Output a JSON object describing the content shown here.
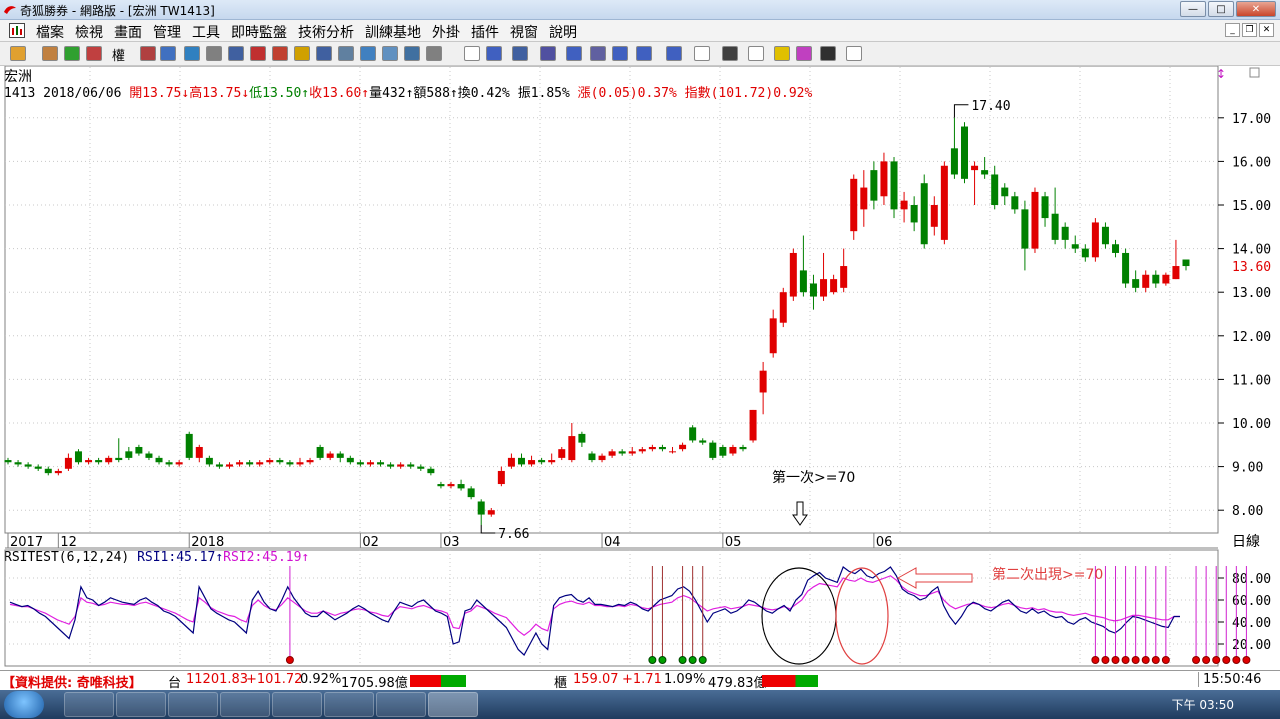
{
  "window": {
    "title": "奇狐勝券 - 網路版 - [宏洲 TW1413]",
    "min": "—",
    "max": "□",
    "close": "✕"
  },
  "menu": [
    "檔案",
    "檢視",
    "畫面",
    "管理",
    "工具",
    "即時監盤",
    "技術分析",
    "訓練基地",
    "外掛",
    "插件",
    "視窗",
    "說明"
  ],
  "toolbar": {
    "rights_label": "權"
  },
  "stock": {
    "name": "宏洲",
    "line2": [
      {
        "text": "1413 2018/06/06 ",
        "color": "blk"
      },
      {
        "text": "開13.75↓",
        "color": "red"
      },
      {
        "text": "高13.75↓",
        "color": "red"
      },
      {
        "text": "低13.50↑",
        "color": "green"
      },
      {
        "text": "收13.60↑",
        "color": "red"
      },
      {
        "text": "量432↑",
        "color": "blk"
      },
      {
        "text": "額588↑",
        "color": "blk"
      },
      {
        "text": "換0.42% ",
        "color": "blk"
      },
      {
        "text": "振1.85% ",
        "color": "blk"
      },
      {
        "text": "漲(0.05)0.37% ",
        "color": "red"
      },
      {
        "text": "指數(101.72)0.92%",
        "color": "red"
      }
    ]
  },
  "rsi_header": [
    {
      "text": "RSITEST(6,12,24) ",
      "color": "blk"
    },
    {
      "text": "RSI1:45.17↑",
      "color": "navy"
    },
    {
      "text": "RSI2:45.19↑",
      "color": "mag"
    }
  ],
  "annotations": {
    "first": "第一次>=70",
    "second": "第二次出現>=70",
    "high": "17.40",
    "low": "7.66",
    "last_price": "13.60",
    "period": "日線"
  },
  "chart_data": {
    "type": "candlestick",
    "ylim": [
      7.5,
      17.5
    ],
    "y_ticks": [
      "17.00",
      "16.00",
      "15.00",
      "14.00",
      "13.00",
      "12.00",
      "11.00",
      "10.00",
      "9.00",
      "8.00"
    ],
    "x_labels": [
      {
        "label": "2017",
        "i": 0
      },
      {
        "label": "12",
        "i": 5
      },
      {
        "label": "2018",
        "i": 18
      },
      {
        "label": "02",
        "i": 35
      },
      {
        "label": "03",
        "i": 43
      },
      {
        "label": "04",
        "i": 59
      },
      {
        "label": "05",
        "i": 71
      },
      {
        "label": "06",
        "i": 86
      }
    ],
    "rsi_ticks": [
      "80.00",
      "60.00",
      "40.00",
      "20.00"
    ],
    "rsi_ylim": [
      0,
      100
    ],
    "candles": [
      [
        9.15,
        9.1,
        9.2,
        9.05
      ],
      [
        9.1,
        9.05,
        9.15,
        9.0
      ],
      [
        9.05,
        9.0,
        9.1,
        8.95
      ],
      [
        9.0,
        8.95,
        9.05,
        8.9
      ],
      [
        8.95,
        8.85,
        9.0,
        8.8
      ],
      [
        8.85,
        8.9,
        8.95,
        8.8
      ],
      [
        8.95,
        9.2,
        9.3,
        8.9
      ],
      [
        9.35,
        9.1,
        9.4,
        9.05
      ],
      [
        9.1,
        9.15,
        9.2,
        9.05
      ],
      [
        9.15,
        9.1,
        9.2,
        9.05
      ],
      [
        9.1,
        9.2,
        9.25,
        9.05
      ],
      [
        9.2,
        9.15,
        9.65,
        9.1
      ],
      [
        9.35,
        9.2,
        9.45,
        9.15
      ],
      [
        9.45,
        9.3,
        9.5,
        9.25
      ],
      [
        9.3,
        9.2,
        9.35,
        9.15
      ],
      [
        9.2,
        9.1,
        9.25,
        9.05
      ],
      [
        9.1,
        9.05,
        9.15,
        9.0
      ],
      [
        9.05,
        9.1,
        9.15,
        9.0
      ],
      [
        9.75,
        9.2,
        9.8,
        9.15
      ],
      [
        9.2,
        9.45,
        9.5,
        9.1
      ],
      [
        9.2,
        9.05,
        9.25,
        9.0
      ],
      [
        9.05,
        9.0,
        9.1,
        8.95
      ],
      [
        9.0,
        9.05,
        9.1,
        8.95
      ],
      [
        9.05,
        9.1,
        9.15,
        9.0
      ],
      [
        9.1,
        9.05,
        9.15,
        9.0
      ],
      [
        9.05,
        9.1,
        9.15,
        9.0
      ],
      [
        9.1,
        9.15,
        9.2,
        9.05
      ],
      [
        9.15,
        9.1,
        9.2,
        9.05
      ],
      [
        9.1,
        9.05,
        9.15,
        9.0
      ],
      [
        9.05,
        9.1,
        9.2,
        9.0
      ],
      [
        9.1,
        9.15,
        9.2,
        9.05
      ],
      [
        9.45,
        9.2,
        9.5,
        9.15
      ],
      [
        9.2,
        9.3,
        9.35,
        9.15
      ],
      [
        9.3,
        9.2,
        9.35,
        9.1
      ],
      [
        9.2,
        9.1,
        9.25,
        9.05
      ],
      [
        9.1,
        9.05,
        9.15,
        9.0
      ],
      [
        9.05,
        9.1,
        9.15,
        9.0
      ],
      [
        9.1,
        9.05,
        9.15,
        9.0
      ],
      [
        9.05,
        9.0,
        9.1,
        8.95
      ],
      [
        9.0,
        9.05,
        9.1,
        8.95
      ],
      [
        9.05,
        9.0,
        9.1,
        8.95
      ],
      [
        9.0,
        8.95,
        9.05,
        8.9
      ],
      [
        8.95,
        8.85,
        9.0,
        8.8
      ],
      [
        8.6,
        8.55,
        8.65,
        8.5
      ],
      [
        8.55,
        8.6,
        8.65,
        8.5
      ],
      [
        8.6,
        8.5,
        8.7,
        8.45
      ],
      [
        8.5,
        8.3,
        8.55,
        8.25
      ],
      [
        8.2,
        7.9,
        8.25,
        7.66
      ],
      [
        7.9,
        8.0,
        8.05,
        7.85
      ],
      [
        8.6,
        8.9,
        9.0,
        8.55
      ],
      [
        9.0,
        9.2,
        9.3,
        8.95
      ],
      [
        9.2,
        9.05,
        9.3,
        9.0
      ],
      [
        9.05,
        9.15,
        9.25,
        9.0
      ],
      [
        9.15,
        9.1,
        9.2,
        9.05
      ],
      [
        9.1,
        9.15,
        9.3,
        9.05
      ],
      [
        9.2,
        9.4,
        9.45,
        9.15
      ],
      [
        9.15,
        9.7,
        10.0,
        9.1
      ],
      [
        9.75,
        9.55,
        9.8,
        9.45
      ],
      [
        9.3,
        9.15,
        9.35,
        9.1
      ],
      [
        9.15,
        9.25,
        9.3,
        9.1
      ],
      [
        9.25,
        9.35,
        9.4,
        9.2
      ],
      [
        9.35,
        9.3,
        9.4,
        9.25
      ],
      [
        9.3,
        9.35,
        9.45,
        9.25
      ],
      [
        9.35,
        9.4,
        9.45,
        9.3
      ],
      [
        9.4,
        9.45,
        9.5,
        9.35
      ],
      [
        9.45,
        9.4,
        9.5,
        9.35
      ],
      [
        9.35,
        9.35,
        9.45,
        9.3
      ],
      [
        9.4,
        9.5,
        9.55,
        9.35
      ],
      [
        9.9,
        9.6,
        9.95,
        9.55
      ],
      [
        9.6,
        9.55,
        9.65,
        9.5
      ],
      [
        9.55,
        9.2,
        9.6,
        9.15
      ],
      [
        9.45,
        9.25,
        9.5,
        9.2
      ],
      [
        9.3,
        9.45,
        9.5,
        9.25
      ],
      [
        9.45,
        9.4,
        9.5,
        9.35
      ],
      [
        9.6,
        10.3,
        10.3,
        9.55
      ],
      [
        10.7,
        11.2,
        11.4,
        10.2
      ],
      [
        11.6,
        12.4,
        12.6,
        11.5
      ],
      [
        12.3,
        13.0,
        13.1,
        12.2
      ],
      [
        12.9,
        13.9,
        14.0,
        12.8
      ],
      [
        13.5,
        13.0,
        14.3,
        12.9
      ],
      [
        13.2,
        12.9,
        13.4,
        12.6
      ],
      [
        12.9,
        13.3,
        13.9,
        12.8
      ],
      [
        13.0,
        13.3,
        13.4,
        12.95
      ],
      [
        13.1,
        13.6,
        14.0,
        13.0
      ],
      [
        14.4,
        15.6,
        15.7,
        14.2
      ],
      [
        14.9,
        15.4,
        15.8,
        14.5
      ],
      [
        15.8,
        15.1,
        16.0,
        14.9
      ],
      [
        15.2,
        16.0,
        16.2,
        15.0
      ],
      [
        16.0,
        14.9,
        16.1,
        14.7
      ],
      [
        14.9,
        15.1,
        15.3,
        14.6
      ],
      [
        15.0,
        14.6,
        15.2,
        14.4
      ],
      [
        15.5,
        14.1,
        15.7,
        14.0
      ],
      [
        14.5,
        15.0,
        15.2,
        14.3
      ],
      [
        14.2,
        15.9,
        16.0,
        14.1
      ],
      [
        16.3,
        15.7,
        17.0,
        15.6
      ],
      [
        16.8,
        15.6,
        16.9,
        15.5
      ],
      [
        15.8,
        15.9,
        16.0,
        15.0
      ],
      [
        15.8,
        15.7,
        16.1,
        15.6
      ],
      [
        15.7,
        15.0,
        15.9,
        14.9
      ],
      [
        15.4,
        15.2,
        15.5,
        15.0
      ],
      [
        15.2,
        14.9,
        15.3,
        14.8
      ],
      [
        14.9,
        14.0,
        15.1,
        13.5
      ],
      [
        14.0,
        15.3,
        15.4,
        13.9
      ],
      [
        15.2,
        14.7,
        15.3,
        14.5
      ],
      [
        14.8,
        14.2,
        15.4,
        14.1
      ],
      [
        14.5,
        14.2,
        14.6,
        14.0
      ],
      [
        14.1,
        14.0,
        14.3,
        13.9
      ],
      [
        14.0,
        13.8,
        14.1,
        13.7
      ],
      [
        13.8,
        14.6,
        14.7,
        13.7
      ],
      [
        14.5,
        14.1,
        14.6,
        14.0
      ],
      [
        14.1,
        13.9,
        14.2,
        13.8
      ],
      [
        13.9,
        13.2,
        14.0,
        13.1
      ],
      [
        13.3,
        13.1,
        13.5,
        13.0
      ],
      [
        13.1,
        13.4,
        13.5,
        13.0
      ],
      [
        13.4,
        13.2,
        13.5,
        13.1
      ],
      [
        13.2,
        13.4,
        13.45,
        13.15
      ],
      [
        13.3,
        13.6,
        14.2,
        13.3
      ],
      [
        13.75,
        13.6,
        13.75,
        13.5
      ]
    ],
    "rsi1": [
      58,
      56,
      54,
      55,
      52,
      48,
      45,
      40,
      35,
      30,
      25,
      42,
      72,
      62,
      60,
      55,
      58,
      62,
      60,
      58,
      57,
      56,
      60,
      62,
      58,
      55,
      50,
      48,
      45,
      40,
      35,
      30,
      72,
      62,
      52,
      48,
      45,
      42,
      40,
      35,
      30,
      60,
      68,
      58,
      52,
      50,
      60,
      72,
      62,
      55,
      48,
      45,
      45,
      50,
      46,
      42,
      45,
      48,
      52,
      55,
      52,
      48,
      45,
      42,
      40,
      50,
      58,
      56,
      54,
      58,
      60,
      55,
      50,
      48,
      45,
      20,
      22,
      50,
      52,
      60,
      55,
      50,
      45,
      40,
      35,
      25,
      15,
      10,
      20,
      30,
      20,
      15,
      55,
      62,
      64,
      65,
      60,
      58,
      62,
      56,
      56,
      55,
      54,
      56,
      55,
      58,
      56,
      52,
      50,
      55,
      60,
      62,
      64,
      70,
      72,
      68,
      60,
      50,
      40,
      48,
      50,
      52,
      48,
      50,
      54,
      60,
      58,
      54,
      50,
      48,
      52,
      55,
      50,
      60,
      65,
      78,
      82,
      85,
      80,
      78,
      76,
      90,
      86,
      84,
      88,
      82,
      80,
      84,
      86,
      90,
      82,
      70,
      66,
      64,
      60,
      62,
      68,
      72,
      55,
      45,
      38,
      45,
      54,
      58,
      56,
      52,
      50,
      54,
      58,
      60,
      55,
      50,
      48,
      52,
      48,
      50,
      46,
      44,
      45,
      40,
      38,
      42,
      44,
      40,
      38,
      36,
      32,
      30,
      34,
      40,
      45,
      44,
      42,
      40,
      38,
      36,
      35,
      45,
      45
    ],
    "rsi2": [
      56,
      55,
      54,
      54,
      52,
      50,
      48,
      45,
      42,
      40,
      38,
      45,
      62,
      58,
      57,
      55,
      56,
      58,
      57,
      56,
      56,
      55,
      57,
      58,
      56,
      54,
      52,
      50,
      48,
      45,
      42,
      40,
      62,
      58,
      53,
      50,
      48,
      46,
      45,
      42,
      40,
      55,
      60,
      55,
      52,
      51,
      56,
      62,
      58,
      54,
      50,
      48,
      48,
      50,
      48,
      46,
      48,
      49,
      51,
      52,
      51,
      49,
      48,
      46,
      45,
      50,
      54,
      53,
      52,
      54,
      55,
      53,
      51,
      50,
      48,
      35,
      34,
      48,
      50,
      55,
      53,
      51,
      48,
      46,
      44,
      38,
      32,
      28,
      32,
      38,
      34,
      32,
      52,
      56,
      58,
      59,
      57,
      56,
      58,
      55,
      55,
      54,
      54,
      55,
      54,
      56,
      55,
      53,
      52,
      54,
      56,
      57,
      58,
      62,
      64,
      62,
      58,
      54,
      50,
      52,
      53,
      54,
      52,
      53,
      54,
      56,
      55,
      54,
      52,
      51,
      52,
      54,
      52,
      56,
      60,
      68,
      72,
      75,
      74,
      73,
      72,
      80,
      78,
      77,
      80,
      77,
      76,
      78,
      80,
      82,
      78,
      72,
      68,
      66,
      64,
      64,
      66,
      68,
      60,
      55,
      52,
      54,
      56,
      57,
      56,
      54,
      53,
      54,
      56,
      57,
      55,
      53,
      52,
      53,
      51,
      52,
      50,
      49,
      49,
      47,
      46,
      47,
      48,
      46,
      45,
      44,
      42,
      41,
      42,
      44,
      46,
      46,
      45,
      44,
      43,
      42,
      42,
      45,
      45
    ],
    "signals_red": [
      28,
      108,
      109,
      110,
      111,
      112,
      113,
      114,
      115,
      118,
      119,
      120,
      121,
      122,
      123,
      135
    ],
    "signals_green": [
      64,
      65,
      67,
      68,
      69
    ]
  },
  "status": {
    "provider": "【資料提供: 奇唯科技】",
    "tw_label": "台",
    "tw_value": "11201.83",
    "tw_change": "+101.72",
    "tw_pct": "0.92%",
    "tw_amount": "1705.98億",
    "otc_label": "櫃",
    "otc_value": "159.07",
    "otc_change": "+1.71",
    "otc_pct": "1.09%",
    "otc_amount": "479.83億",
    "time": "15:50:46"
  },
  "taskbar": {
    "clock": "下午 03:50"
  }
}
